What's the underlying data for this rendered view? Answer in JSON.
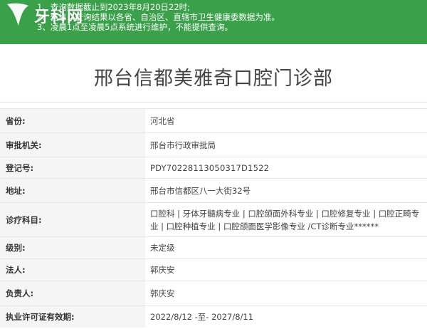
{
  "notice": {
    "lines": [
      "1、查询数据截止到2023年8月20日22时;",
      "2、信息以查询结果以各省、自治区、直辖市卫生健康委数据为准。",
      "3、凌晨1点至凌晨5点系统进行维护，不能提供查询。"
    ],
    "bg_color": "#3aa04a"
  },
  "logo": {
    "text": "牙科网",
    "icon": "tooth-icon"
  },
  "page": {
    "title": "邢台信都美雅奇口腔门诊部"
  },
  "details": [
    {
      "label": "省份:",
      "value": "河北省"
    },
    {
      "label": "审批机关:",
      "value": "邢台市行政审批局"
    },
    {
      "label": "登记号:",
      "value": "PDY70228113050317D1522"
    },
    {
      "label": "地址:",
      "value": "邢台市信都区八一大街32号"
    },
    {
      "label": "诊疗科目:",
      "value": "口腔科 | 牙体牙髓病专业 | 口腔颌面外科专业 | 口腔修复专业 | 口腔正畸专业 | 口腔种植专业 | 口腔颌面医学影像专业 /CT诊断专业******"
    },
    {
      "label": "级别:",
      "value": "未定级"
    },
    {
      "label": "法人:",
      "value": "郭庆安"
    },
    {
      "label": "负责人:",
      "value": "郭庆安"
    },
    {
      "label": "执业许可证有效期:",
      "value": "2022/8/12 -至- 2027/8/11"
    }
  ]
}
